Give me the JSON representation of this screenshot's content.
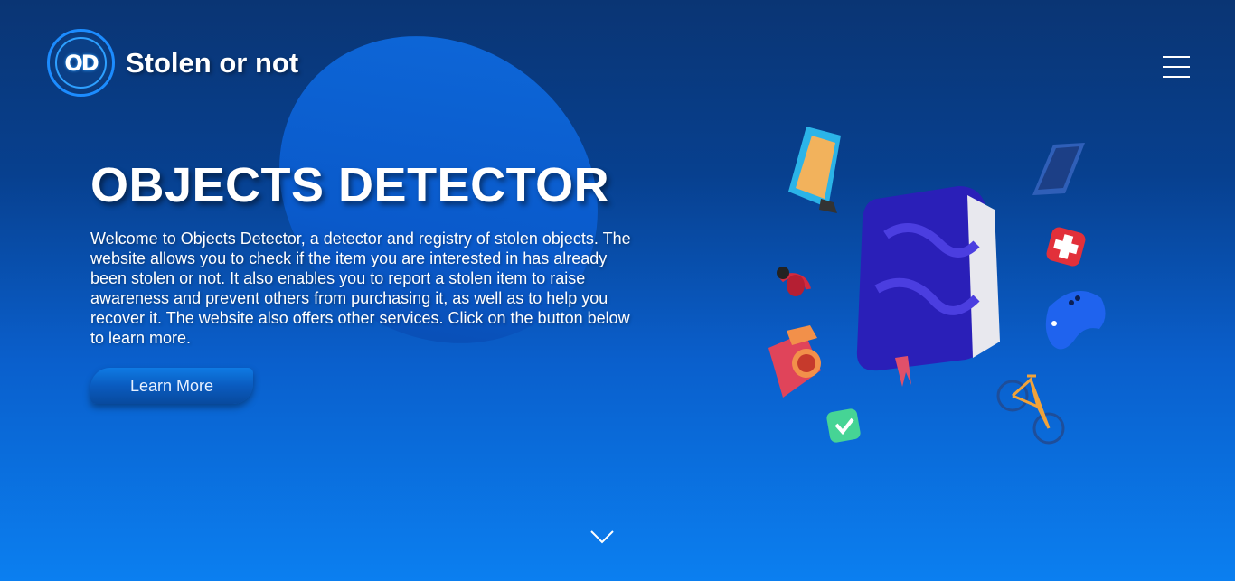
{
  "brand": {
    "logo_initials": "OD",
    "name": "Stolen or not"
  },
  "nav": {
    "menu_icon": "hamburger-menu-icon"
  },
  "hero": {
    "title": "OBJECTS DETECTOR",
    "description": "Welcome to Objects Detector, a detector and registry of stolen objects. The website allows you to check if the item you are interested in has already been stolen or not. It also enables you to report a stolen item to raise awareness and prevent others from purchasing it, as well as to help you recover it. The website also offers other services. Click on the button below to learn more.",
    "cta_label": "Learn More",
    "illustration_items": [
      "monitor-icon",
      "hard-drive-icon",
      "first-aid-icon",
      "headphones-icon",
      "book-icon",
      "gamepad-icon",
      "camera-icon",
      "bicycle-icon",
      "checkmark-icon"
    ]
  },
  "scroll": {
    "icon": "chevron-down-icon"
  },
  "colors": {
    "background_top": "#0a3574",
    "background_bottom": "#0b7ff0",
    "accent": "#1c8cff",
    "book": "#2a1fb8"
  }
}
